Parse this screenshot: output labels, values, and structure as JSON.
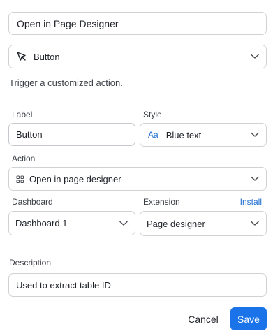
{
  "title_field": {
    "value": "Open in Page Designer"
  },
  "type_select": {
    "icon": "cursor-arrow-icon",
    "value": "Button"
  },
  "description_text": "Trigger a customized action.",
  "label_field": {
    "label": "Label",
    "value": "Button"
  },
  "style_field": {
    "label": "Style",
    "icon_text": "Aa",
    "value": "Blue text",
    "accent": "#1f6fd1"
  },
  "action_field": {
    "label": "Action",
    "icon": "grid-icon",
    "value": "Open in page designer"
  },
  "dashboard_field": {
    "label": "Dashboard",
    "value": "Dashboard 1"
  },
  "extension_field": {
    "label": "Extension",
    "link": "Install",
    "value": "Page designer"
  },
  "description_field": {
    "label": "Description",
    "value": "Used to extract table ID"
  },
  "footer": {
    "cancel": "Cancel",
    "save": "Save",
    "save_color": "#1a73e8"
  }
}
